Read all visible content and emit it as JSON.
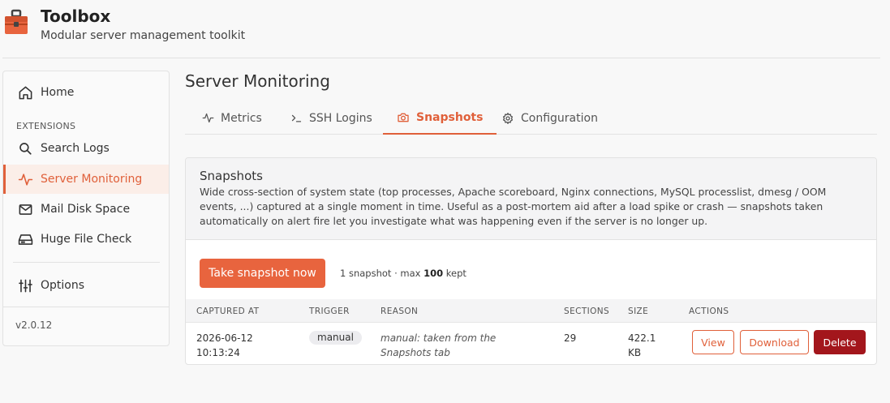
{
  "app": {
    "title": "Toolbox",
    "subtitle": "Modular server management toolkit",
    "accent": "#e0603a",
    "logo_icon": "toolbox-icon"
  },
  "sidebar": {
    "items": [
      {
        "label": "Home",
        "icon": "home-icon"
      },
      {
        "label": "Search Logs",
        "icon": "search-icon"
      },
      {
        "label": "Server Monitoring",
        "icon": "activity-icon",
        "active": true
      },
      {
        "label": "Mail Disk Space",
        "icon": "mail-icon"
      },
      {
        "label": "Huge File Check",
        "icon": "hard-drive-icon"
      },
      {
        "label": "Options",
        "icon": "sliders-icon"
      }
    ],
    "section_label": "EXTENSIONS",
    "version": "v2.0.12"
  },
  "main": {
    "title": "Server Monitoring",
    "tabs": [
      {
        "label": "Metrics",
        "icon": "activity-icon"
      },
      {
        "label": "SSH Logins",
        "icon": "terminal-icon"
      },
      {
        "label": "Snapshots",
        "icon": "camera-icon",
        "active": true
      },
      {
        "label": "Configuration",
        "icon": "gear-icon"
      }
    ]
  },
  "snapshots": {
    "title": "Snapshots",
    "description": "Wide cross-section of system state (top processes, Apache scoreboard, Nginx connections, MySQL processlist, dmesg / OOM events, ...) captured at a single moment in time. Useful as a post-mortem aid after a load spike or crash — snapshots taken automatically on alert fire let you investigate what was happening even if the server is no longer up.",
    "take_button": "Take snapshot now",
    "info_prefix": "1 snapshot · max ",
    "info_max": "100",
    "info_suffix": " kept",
    "columns": [
      "CAPTURED AT",
      "TRIGGER",
      "REASON",
      "SECTIONS",
      "SIZE",
      "ACTIONS"
    ],
    "rows": [
      {
        "captured_date": "2026-06-12",
        "captured_time": "10:13:24",
        "trigger": "manual",
        "reason": "manual: taken from the Snapshots tab",
        "sections": "29",
        "size_value": "422.1",
        "size_unit": "KB",
        "actions": {
          "view": "View",
          "download": "Download",
          "delete": "Delete"
        }
      }
    ]
  }
}
